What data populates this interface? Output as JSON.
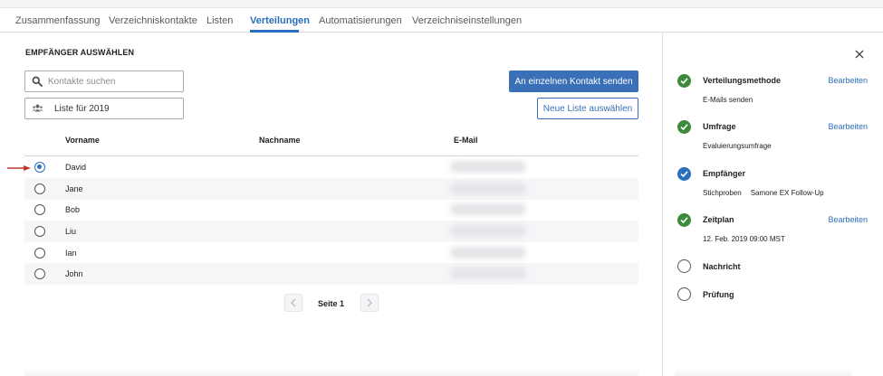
{
  "tabs": [
    {
      "label": "Zusammenfassung"
    },
    {
      "label": "Verzeichniskontakte"
    },
    {
      "label": "Listen"
    },
    {
      "label": "Verteilungen"
    },
    {
      "label": "Automatisierungen"
    },
    {
      "label": "Verzeichniseinstellungen"
    }
  ],
  "active_tab": "Verteilungen",
  "recipients": {
    "title": "EMPFÄNGER AUSWÄHLEN",
    "search_placeholder": "Kontakte suchen",
    "list_value": "Liste für 2019",
    "send_single_button": "An einzelnen Kontakt senden",
    "new_list_button": "Neue Liste auswählen",
    "columns": {
      "first_name": "Vorname",
      "last_name": "Nachname",
      "email": "E-Mail"
    },
    "rows": [
      {
        "first_name": "David",
        "selected": true
      },
      {
        "first_name": "Jane",
        "selected": false
      },
      {
        "first_name": "Bob",
        "selected": false
      },
      {
        "first_name": "Liu",
        "selected": false
      },
      {
        "first_name": "Ian",
        "selected": false
      },
      {
        "first_name": "John",
        "selected": false
      }
    ],
    "page_label": "Seite 1"
  },
  "steps": {
    "edit_label": "Bearbeiten",
    "items": [
      {
        "title": "Verteilungsmethode",
        "detail": "E-Mails senden",
        "status": "done"
      },
      {
        "title": "Umfrage",
        "detail": "Evaluierungsumfrage",
        "status": "done"
      },
      {
        "title": "Empfänger",
        "detail_a": "Stichproben",
        "detail_b": "Samone EX Follow-Up",
        "status": "current"
      },
      {
        "title": "Zeitplan",
        "detail": "12. Feb. 2019 09:00 MST",
        "status": "done"
      },
      {
        "title": "Nachricht",
        "status": "todo"
      },
      {
        "title": "Prüfung",
        "status": "todo"
      }
    ]
  },
  "colors": {
    "accent": "#2a6ebd",
    "primary_button": "#3a70b8",
    "done": "#3e8a3d",
    "arrow": "#c0392b"
  }
}
